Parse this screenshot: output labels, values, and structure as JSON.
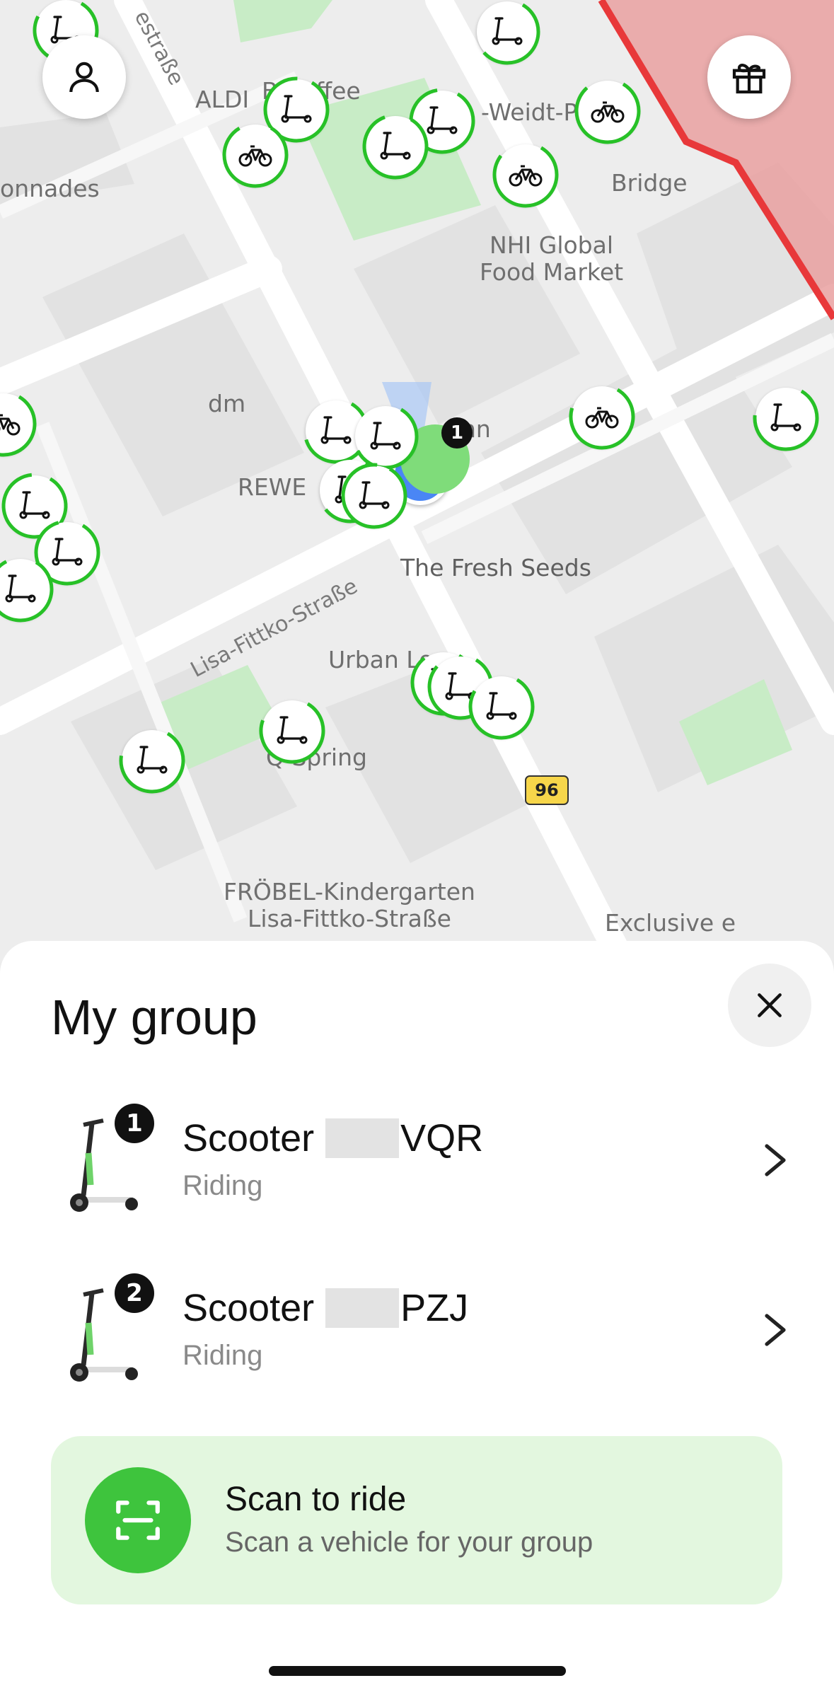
{
  "map": {
    "pois": {
      "aldi": "ALDI",
      "coffee": "B   Coffee",
      "weidt": "-Weidt-Pl",
      "bridge": "Bridge",
      "nhi": "NHI Global\nFood Market",
      "colonnades": "onnades",
      "dm": "dm",
      "rewe": "REWE",
      "bahn": "hn",
      "fresh_seeds": "The Fresh Seeds",
      "urban": "Urban Lo",
      "spring": "Q   Spring",
      "froebel": "FRÖBEL-Kindergarten\nLisa-Fittko-Straße",
      "exclusive": "Exclusive    e"
    },
    "streets": {
      "top": "estraße",
      "lisa": "Lisa-Fittko-Straße"
    },
    "route_badge": "96",
    "group_marker_number": "1",
    "buttons": {
      "profile_icon": "person-icon",
      "gift_icon": "gift-icon"
    },
    "colors": {
      "zone_red": "#e8383a",
      "zone_fill": "#e9a0a0",
      "park": "#c8ecc6",
      "ring": "#27c127",
      "user_dot": "#4a86f5"
    }
  },
  "sheet": {
    "title": "My group",
    "close_icon": "close-icon",
    "vehicles": [
      {
        "number": "1",
        "prefix": "Scooter",
        "suffix": "VQR",
        "status": "Riding"
      },
      {
        "number": "2",
        "prefix": "Scooter",
        "suffix": "PZJ",
        "status": "Riding"
      }
    ],
    "scan": {
      "title": "Scan to ride",
      "subtitle": "Scan a vehicle for your group",
      "icon": "scan-icon"
    }
  }
}
